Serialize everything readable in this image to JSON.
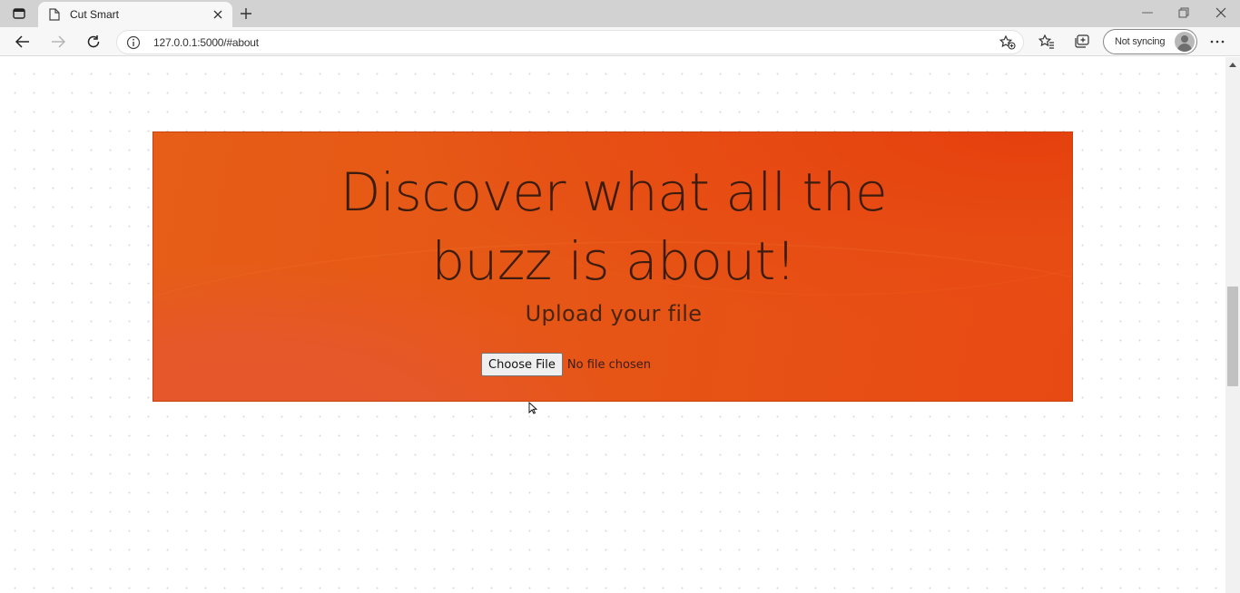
{
  "browser": {
    "tab": {
      "title": "Cut Smart"
    },
    "address": {
      "url": "127.0.0.1:5000/#about"
    },
    "profile": {
      "label": "Not syncing"
    },
    "icons": {
      "tab_actions": "tab-actions-icon",
      "favicon": "page-icon",
      "tab_close": "close-icon",
      "new_tab": "plus-icon",
      "minimize": "minimize-icon",
      "restore": "restore-icon",
      "close_window": "close-icon",
      "back": "back-arrow-icon",
      "forward": "forward-arrow-icon",
      "refresh": "refresh-icon",
      "site_info": "info-icon",
      "add_favorite": "star-add-icon",
      "favorites": "favorites-icon",
      "collections": "collections-icon",
      "more": "more-icon"
    }
  },
  "hero": {
    "headline_line1": "Discover what all the",
    "headline_line2": "buzz is about!",
    "subhead": "Upload your file",
    "choose_file_label": "Choose File",
    "file_status": "No file chosen"
  },
  "colors": {
    "hero_orange": "#e65616",
    "headline_text": "#3b1c0e",
    "tabstrip": "#d2d2d2"
  }
}
